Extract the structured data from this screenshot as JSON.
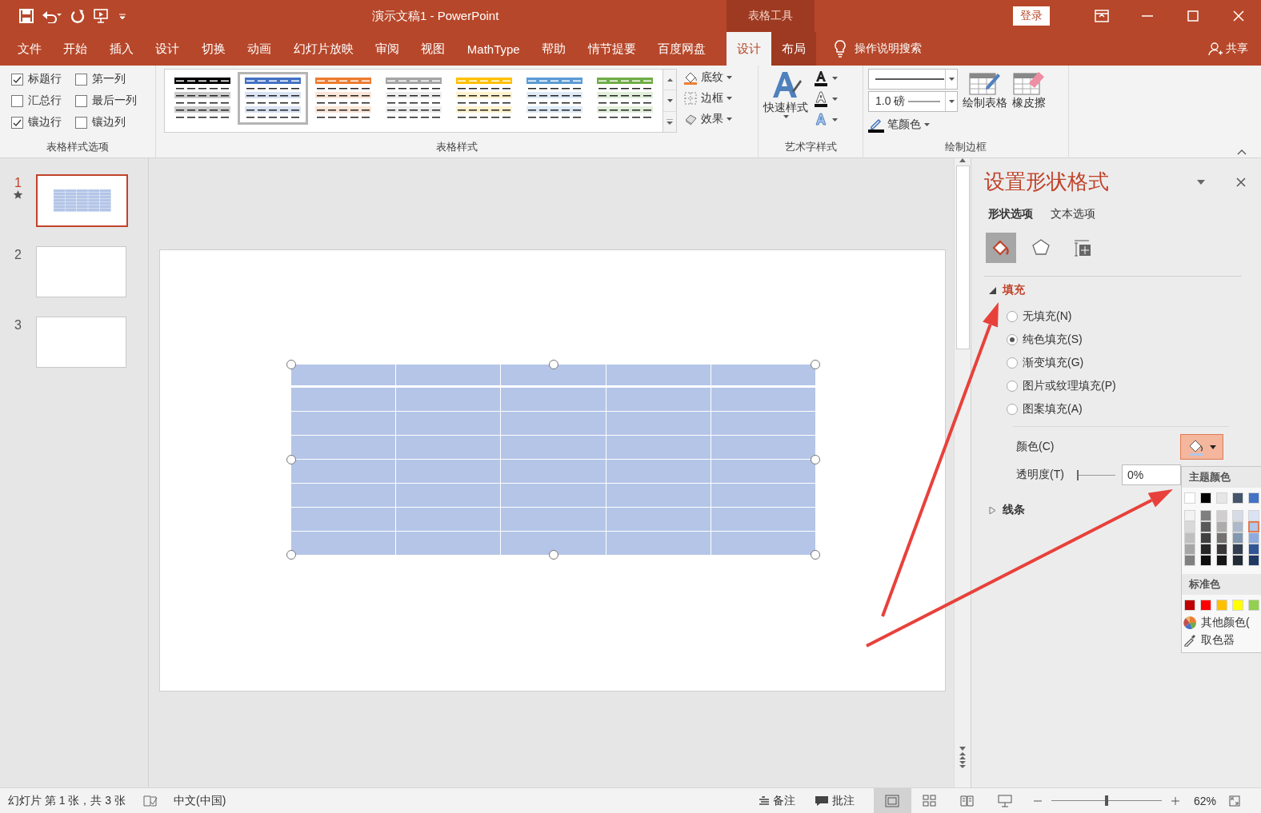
{
  "window": {
    "title": "演示文稿1  -  PowerPoint",
    "context_group": "表格工具",
    "login_button": "登录"
  },
  "ribbon_tabs": [
    {
      "label": "文件",
      "selected": false,
      "contextual": false
    },
    {
      "label": "开始",
      "selected": false,
      "contextual": false
    },
    {
      "label": "插入",
      "selected": false,
      "contextual": false
    },
    {
      "label": "设计",
      "selected": false,
      "contextual": false
    },
    {
      "label": "切换",
      "selected": false,
      "contextual": false
    },
    {
      "label": "动画",
      "selected": false,
      "contextual": false
    },
    {
      "label": "幻灯片放映",
      "selected": false,
      "contextual": false
    },
    {
      "label": "审阅",
      "selected": false,
      "contextual": false
    },
    {
      "label": "视图",
      "selected": false,
      "contextual": false
    },
    {
      "label": "MathType",
      "selected": false,
      "contextual": false
    },
    {
      "label": "帮助",
      "selected": false,
      "contextual": false
    },
    {
      "label": "情节提要",
      "selected": false,
      "contextual": false
    },
    {
      "label": "百度网盘",
      "selected": false,
      "contextual": false
    },
    {
      "label": "设计",
      "selected": true,
      "contextual": true
    },
    {
      "label": "布局",
      "selected": false,
      "contextual": true
    }
  ],
  "tell_me": "操作说明搜索",
  "share": "共享",
  "table_style_options": {
    "title": "表格样式选项",
    "options": [
      {
        "label": "标题行",
        "checked": true
      },
      {
        "label": "第一列",
        "checked": false
      },
      {
        "label": "汇总行",
        "checked": false
      },
      {
        "label": "最后一列",
        "checked": false
      },
      {
        "label": "镶边行",
        "checked": true
      },
      {
        "label": "镶边列",
        "checked": false
      }
    ]
  },
  "table_styles": {
    "title": "表格样式",
    "styles": [
      {
        "color": "#000000",
        "selected": false
      },
      {
        "color": "#4472c4",
        "selected": true
      },
      {
        "color": "#ed7d31",
        "selected": false
      },
      {
        "color": "#a5a5a5",
        "selected": false
      },
      {
        "color": "#ffc000",
        "selected": false
      },
      {
        "color": "#5b9bd5",
        "selected": false
      },
      {
        "color": "#70ad47",
        "selected": false
      }
    ],
    "buttons": [
      {
        "label": "底纹",
        "kind": "shading"
      },
      {
        "label": "边框",
        "kind": "borders"
      },
      {
        "label": "效果",
        "kind": "effects"
      }
    ]
  },
  "wordart_styles": {
    "title": "艺术字样式",
    "quick_styles": "快速样式"
  },
  "draw_borders": {
    "title": "绘制边框",
    "pen_weight": "1.0 磅",
    "pen_color": "笔颜色",
    "draw_table": "绘制表格",
    "eraser": "橡皮擦"
  },
  "slides": [
    {
      "number": "1",
      "selected": true,
      "transition": true,
      "kind": "table"
    },
    {
      "number": "2",
      "selected": false,
      "transition": false,
      "kind": "blank"
    },
    {
      "number": "3",
      "selected": false,
      "transition": false,
      "kind": "blank"
    }
  ],
  "slide_table": {
    "selected": true
  },
  "format_pane": {
    "title": "设置形状格式",
    "tabs": [
      {
        "label": "形状选项",
        "selected": true
      },
      {
        "label": "文本选项",
        "selected": false
      }
    ],
    "icon_tabs": [
      {
        "kind": "fill",
        "selected": true
      },
      {
        "kind": "effects",
        "selected": false
      },
      {
        "kind": "size",
        "selected": false
      }
    ],
    "fill": {
      "title": "填充",
      "expanded": true,
      "options": [
        {
          "label": "无填充(N)",
          "selected": false
        },
        {
          "label": "纯色填充(S)",
          "selected": true
        },
        {
          "label": "渐变填充(G)",
          "selected": false
        },
        {
          "label": "图片或纹理填充(P)",
          "selected": false
        },
        {
          "label": "图案填充(A)",
          "selected": false
        }
      ],
      "color_label": "颜色(C)",
      "transparency_label": "透明度(T)",
      "transparency": {
        "level": 0
      },
      "transparency_value": "0%"
    },
    "line": {
      "title": "线条",
      "expanded": false
    }
  },
  "color_menu": {
    "theme_title": "主题颜色",
    "theme_columns": [
      {
        "swatches": [
          {
            "color": "#ffffff",
            "selected": false
          },
          {
            "color": "#f2f2f2",
            "selected": false
          },
          {
            "color": "#d9d9d9",
            "selected": false
          },
          {
            "color": "#bfbfbf",
            "selected": false
          },
          {
            "color": "#a6a6a6",
            "selected": false
          },
          {
            "color": "#808080",
            "selected": false
          }
        ]
      },
      {
        "swatches": [
          {
            "color": "#000000",
            "selected": false
          },
          {
            "color": "#7f7f7f",
            "selected": false
          },
          {
            "color": "#595959",
            "selected": false
          },
          {
            "color": "#404040",
            "selected": false
          },
          {
            "color": "#262626",
            "selected": false
          },
          {
            "color": "#0d0d0d",
            "selected": false
          }
        ]
      },
      {
        "swatches": [
          {
            "color": "#e7e6e6",
            "selected": false
          },
          {
            "color": "#d0cece",
            "selected": false
          },
          {
            "color": "#aeabab",
            "selected": false
          },
          {
            "color": "#757171",
            "selected": false
          },
          {
            "color": "#3a3838",
            "selected": false
          },
          {
            "color": "#171616",
            "selected": false
          }
        ]
      },
      {
        "swatches": [
          {
            "color": "#44546a",
            "selected": false
          },
          {
            "color": "#d6dce5",
            "selected": false
          },
          {
            "color": "#adb9ca",
            "selected": false
          },
          {
            "color": "#8497b0",
            "selected": false
          },
          {
            "color": "#333f50",
            "selected": false
          },
          {
            "color": "#222a35",
            "selected": false
          }
        ]
      },
      {
        "swatches": [
          {
            "color": "#4472c4",
            "selected": false
          },
          {
            "color": "#dae3f3",
            "selected": false
          },
          {
            "color": "#b4c7e7",
            "selected": true
          },
          {
            "color": "#8faadc",
            "selected": false
          },
          {
            "color": "#2f5597",
            "selected": false
          },
          {
            "color": "#203864",
            "selected": false
          }
        ]
      }
    ],
    "standard_title": "标准色",
    "standard_colors": [
      {
        "color": "#c00000"
      },
      {
        "color": "#ff0000"
      },
      {
        "color": "#ffc000"
      },
      {
        "color": "#ffff00"
      },
      {
        "color": "#92d050"
      }
    ],
    "items": [
      {
        "label": "其他颜色(",
        "kind": "more"
      },
      {
        "label": "取色器",
        "kind": "eyedropper"
      }
    ]
  },
  "status_bar": {
    "slide_info": "幻灯片 第 1 张，共 3 张",
    "language": "中文(中国)",
    "notes": "备注",
    "comments": "批注",
    "views": [
      {
        "kind": "normal",
        "selected": true
      },
      {
        "kind": "sorter",
        "selected": false
      },
      {
        "kind": "reading",
        "selected": false
      },
      {
        "kind": "slideshow",
        "selected": false
      }
    ],
    "zoom": {
      "level": 0.5
    },
    "zoom_value": "62%"
  },
  "annotations": [
    {
      "kind": "arrow"
    },
    {
      "kind": "arrow"
    }
  ]
}
